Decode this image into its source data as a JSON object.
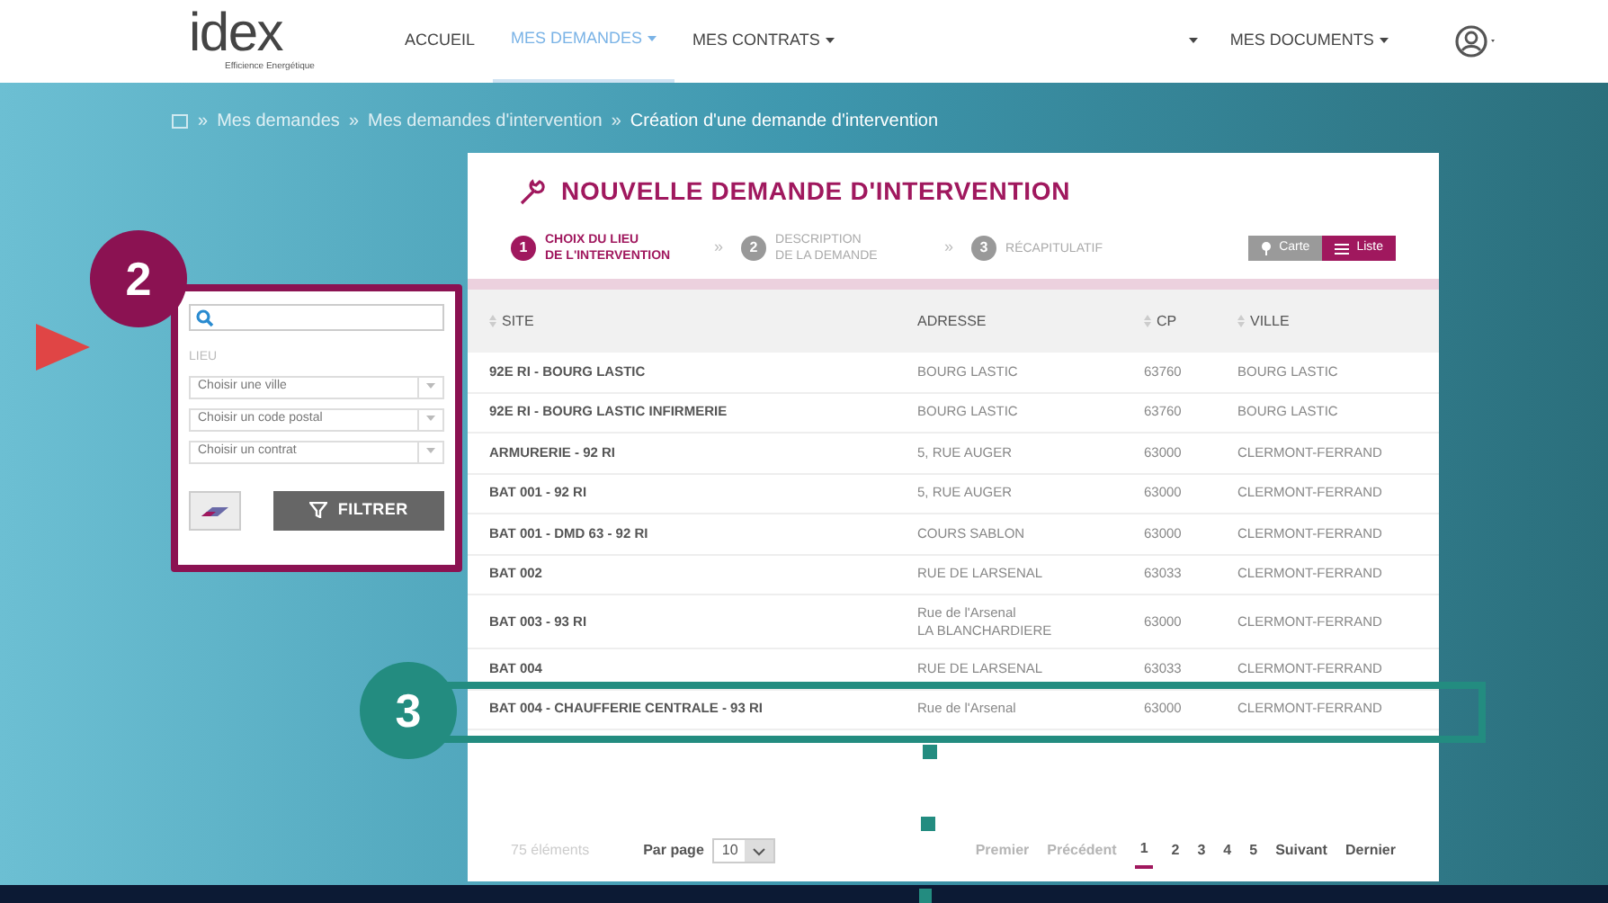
{
  "logo": {
    "text": "idex",
    "tagline": "Efficience Energétique"
  },
  "nav": [
    {
      "label": "ACCUEIL",
      "dropdown": false,
      "selected": false
    },
    {
      "label": "MES DEMANDES",
      "dropdown": true,
      "selected": true
    },
    {
      "label": "MES CONTRATS",
      "dropdown": true,
      "selected": false
    },
    {
      "dropdown": true,
      "selected": false
    },
    {
      "label": "MES DOCUMENTS",
      "dropdown": true,
      "selected": false
    }
  ],
  "breadcrumb": {
    "separator": "»",
    "items": [
      "Mes demandes",
      "Mes demandes d'intervention",
      "Création d'une demande d'intervention"
    ]
  },
  "step_separator": "»",
  "title": "NOUVELLE DEMANDE D'INTERVENTION",
  "steps": [
    {
      "number": "1",
      "label": "CHOIX DU LIEU\nDE L'INTERVENTION",
      "selected": true
    },
    {
      "number": "2",
      "label": "DESCRIPTION\nDE LA DEMANDE",
      "selected": false
    },
    {
      "number": "3",
      "label": "RÉCAPITULATIF",
      "selected": false
    }
  ],
  "views": [
    {
      "label": "Carte",
      "kind": "map",
      "selected": false
    },
    {
      "label": "Liste",
      "kind": "list",
      "selected": true
    }
  ],
  "filter": {
    "section_label": "LIEU",
    "selects": [
      {
        "placeholder": "Choisir une ville"
      },
      {
        "placeholder": "Choisir un code postal"
      },
      {
        "placeholder": "Choisir un contrat"
      }
    ],
    "filter_button": "FILTRER"
  },
  "table": {
    "columns": [
      {
        "label": "SITE",
        "sortable": true
      },
      {
        "label": "ADRESSE",
        "sortable": false
      },
      {
        "label": "CP",
        "sortable": true
      },
      {
        "label": "VILLE",
        "sortable": true
      }
    ],
    "rows": [
      [
        "92E RI - BOURG LASTIC",
        "BOURG LASTIC",
        "63760",
        "BOURG LASTIC"
      ],
      [
        "92E RI - BOURG LASTIC INFIRMERIE",
        "BOURG LASTIC",
        "63760",
        "BOURG LASTIC"
      ],
      [
        "ARMURERIE - 92 RI",
        "5, RUE AUGER",
        "63000",
        "CLERMONT-FERRAND"
      ],
      [
        "BAT 001 - 92 RI",
        "5, RUE AUGER",
        "63000",
        "CLERMONT-FERRAND"
      ],
      [
        "BAT 001 - DMD 63 - 92 RI",
        "COURS SABLON",
        "63000",
        "CLERMONT-FERRAND"
      ],
      [
        "BAT 002",
        "RUE DE LARSENAL",
        "63033",
        "CLERMONT-FERRAND"
      ],
      [
        "BAT 003 - 93 RI",
        "Rue de l'Arsenal\nLA BLANCHARDIERE",
        "63000",
        "CLERMONT-FERRAND"
      ],
      [
        "BAT 004",
        "RUE DE LARSENAL",
        "63033",
        "CLERMONT-FERRAND"
      ],
      [
        "BAT 004 - CHAUFFERIE CENTRALE - 93 RI",
        "Rue de l'Arsenal",
        "63000",
        "CLERMONT-FERRAND"
      ]
    ]
  },
  "pagination": {
    "count": "75 éléments",
    "per_page_label": "Par page",
    "per_page": "10",
    "links": [
      {
        "label": "Premier",
        "disabled": true,
        "selected": false
      },
      {
        "label": "Précédent",
        "disabled": true,
        "selected": false
      },
      {
        "label": "1",
        "disabled": false,
        "selected": true
      },
      {
        "label": "2",
        "disabled": false,
        "selected": false
      },
      {
        "label": "3",
        "disabled": false,
        "selected": false
      },
      {
        "label": "4",
        "disabled": false,
        "selected": false
      },
      {
        "label": "5",
        "disabled": false,
        "selected": false
      },
      {
        "label": "Suivant",
        "disabled": false,
        "selected": false
      },
      {
        "label": "Dernier",
        "disabled": false,
        "selected": false
      }
    ]
  },
  "annotations": [
    {
      "number": "2",
      "color": "#8b1252"
    },
    {
      "number": "3",
      "color": "#238c80"
    }
  ]
}
